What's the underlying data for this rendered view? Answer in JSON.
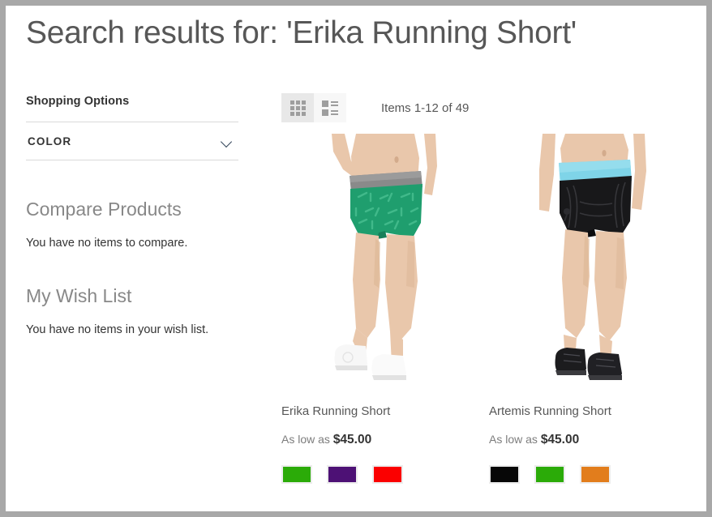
{
  "page": {
    "title": "Search results for: 'Erika Running Short'"
  },
  "sidebar": {
    "shopping_options_title": "Shopping Options",
    "filters": [
      {
        "label": "COLOR",
        "icon": "chevron-down-icon"
      }
    ],
    "compare": {
      "heading": "Compare Products",
      "empty_text": "You have no items to compare."
    },
    "wishlist": {
      "heading": "My Wish List",
      "empty_text": "You have no items in your wish list."
    }
  },
  "toolbar": {
    "modes": [
      {
        "name": "grid-view",
        "icon": "grid-icon",
        "active": true
      },
      {
        "name": "list-view",
        "icon": "list-icon",
        "active": false
      }
    ],
    "items_count": "Items 1-12 of 49"
  },
  "products": [
    {
      "name": "Erika Running Short",
      "price_prefix": "As low as",
      "price": "$45.00",
      "image_alt": "woman wearing green patterned running shorts with gray waistband and white sneakers",
      "image_colors": {
        "shorts": "#1f9e6e",
        "shorts_dark": "#17805a",
        "waistband": "#7d7d7d",
        "skin": "#e8c4a8",
        "shoes": "#f5f5f5"
      },
      "swatches": [
        "#2bab08",
        "#4d1175",
        "#fb0000"
      ]
    },
    {
      "name": "Artemis Running Short",
      "price_prefix": "As low as",
      "price": "$45.00",
      "image_alt": "woman wearing black running shorts with light blue waistband and black shoes",
      "image_colors": {
        "shorts": "#18181a",
        "shorts_dark": "#0c0c0e",
        "waistband": "#7fd4e8",
        "skin": "#e8c4a8",
        "shoes": "#1a1a1c"
      },
      "swatches": [
        "#070707",
        "#2bab08",
        "#e27d1c"
      ]
    }
  ],
  "theme": {
    "frame_border": "#a8a8a8",
    "page_bg": "#ffffff",
    "title_color": "#575757",
    "divider": "#d9d9d9",
    "mode_active_bg": "#e8e8e8",
    "mode_inactive_bg": "#f7f7f7"
  }
}
